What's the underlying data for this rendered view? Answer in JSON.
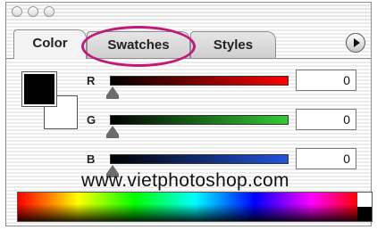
{
  "window": {
    "buttons": [
      "close",
      "minimize",
      "zoom"
    ]
  },
  "tabs": [
    {
      "label": "Color",
      "active": true
    },
    {
      "label": "Swatches",
      "active": false,
      "highlighted": true
    },
    {
      "label": "Styles",
      "active": false
    }
  ],
  "panel_menu": {
    "icon": "triangle-right-icon"
  },
  "swatches": {
    "foreground": "#000000",
    "background": "#ffffff"
  },
  "channels": [
    {
      "label": "R",
      "value": "0",
      "gradient_end": "#ff0000"
    },
    {
      "label": "G",
      "value": "0",
      "gradient_end": "#33cc33"
    },
    {
      "label": "B",
      "value": "0",
      "gradient_end": "#2255dd"
    }
  ],
  "watermark": "www.vietphotoshop.com",
  "colors": {
    "highlight": "#c2187a"
  }
}
